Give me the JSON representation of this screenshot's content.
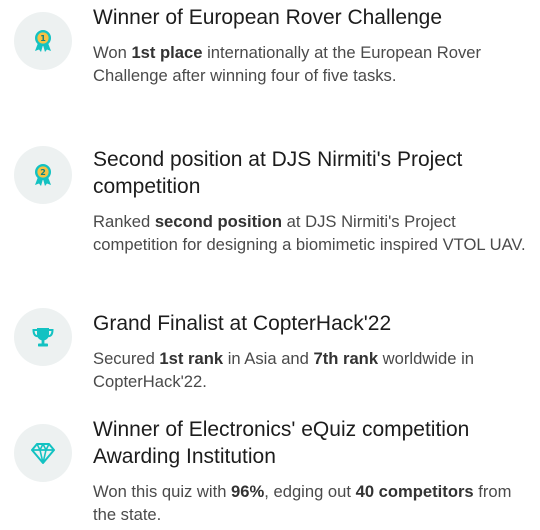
{
  "accent_color": "#13c2c2",
  "achievements": [
    {
      "icon": "award-medal-1-icon",
      "title": "Winner of European Rover Challenge",
      "desc": [
        {
          "text": "Won ",
          "bold": false
        },
        {
          "text": "1st place",
          "bold": true
        },
        {
          "text": " internationally at the European Rover Challenge after winning four of five tasks.",
          "bold": false
        }
      ]
    },
    {
      "icon": "award-medal-2-icon",
      "title": "Second position at DJS Nirmiti's Project competition",
      "desc": [
        {
          "text": "Ranked ",
          "bold": false
        },
        {
          "text": "second position",
          "bold": true
        },
        {
          "text": " at DJS Nirmiti's Project competition for designing a biomimetic inspired VTOL UAV.",
          "bold": false
        }
      ]
    },
    {
      "icon": "trophy-icon",
      "title": "Grand Finalist at CopterHack'22",
      "desc": [
        {
          "text": "Secured ",
          "bold": false
        },
        {
          "text": "1st rank",
          "bold": true
        },
        {
          "text": " in Asia and ",
          "bold": false
        },
        {
          "text": "7th rank",
          "bold": true
        },
        {
          "text": " worldwide in CopterHack'22.",
          "bold": false
        }
      ]
    },
    {
      "icon": "diamond-icon",
      "title": "Winner of Electronics' eQuiz competition Awarding Institution",
      "desc": [
        {
          "text": "Won this quiz with ",
          "bold": false
        },
        {
          "text": "96%",
          "bold": true
        },
        {
          "text": ", edging out ",
          "bold": false
        },
        {
          "text": "40 competitors",
          "bold": true
        },
        {
          "text": " from the state.",
          "bold": false
        }
      ]
    }
  ]
}
